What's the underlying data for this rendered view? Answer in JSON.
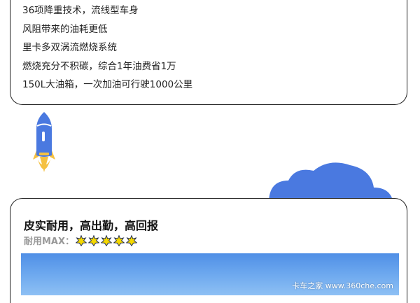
{
  "features": [
    "36项降重技术，流线型车身",
    "风阻带来的油耗更低",
    "里卡多双涡流燃烧系统",
    "燃烧充分不积碳，综合1年油费省1万",
    "150L大油箱，一次加油可行驶1000公里"
  ],
  "section": {
    "title": "皮实耐用，高出勤，高回报",
    "durability_label": "耐用MAX：",
    "durability_stars": 5
  },
  "watermark": "卡车之家 www.360che.com",
  "colors": {
    "accent_blue": "#4a79e0",
    "star_yellow": "#f5d800",
    "flame_yellow": "#f5c142"
  },
  "icons": [
    "rocket-icon",
    "cloud-icon",
    "star-icon"
  ]
}
